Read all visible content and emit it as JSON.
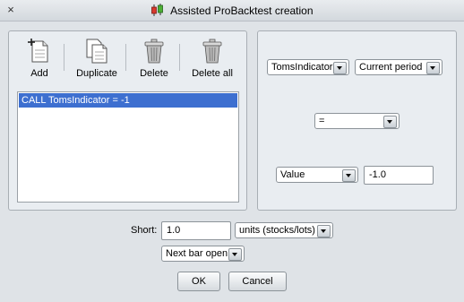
{
  "window": {
    "title": "Assisted ProBacktest creation",
    "close_symbol": "×"
  },
  "toolbar": {
    "add_label": "Add",
    "duplicate_label": "Duplicate",
    "delete_label": "Delete",
    "delete_all_label": "Delete all"
  },
  "conditions": {
    "items": [
      "CALL TomsIndicator = -1"
    ]
  },
  "condition_editor": {
    "indicator_value": "TomsIndicator",
    "period_value": "Current period",
    "operator_value": "=",
    "compare_type_value": "Value",
    "compare_value": "-1.0"
  },
  "order": {
    "short_label": "Short:",
    "quantity_value": "1.0",
    "units_value": "units (stocks/lots)",
    "timing_value": "Next bar open"
  },
  "buttons": {
    "ok_label": "OK",
    "cancel_label": "Cancel"
  },
  "colors": {
    "selection": "#3d6fd0",
    "background": "#dfe3e7",
    "panel": "#e9edf1"
  }
}
